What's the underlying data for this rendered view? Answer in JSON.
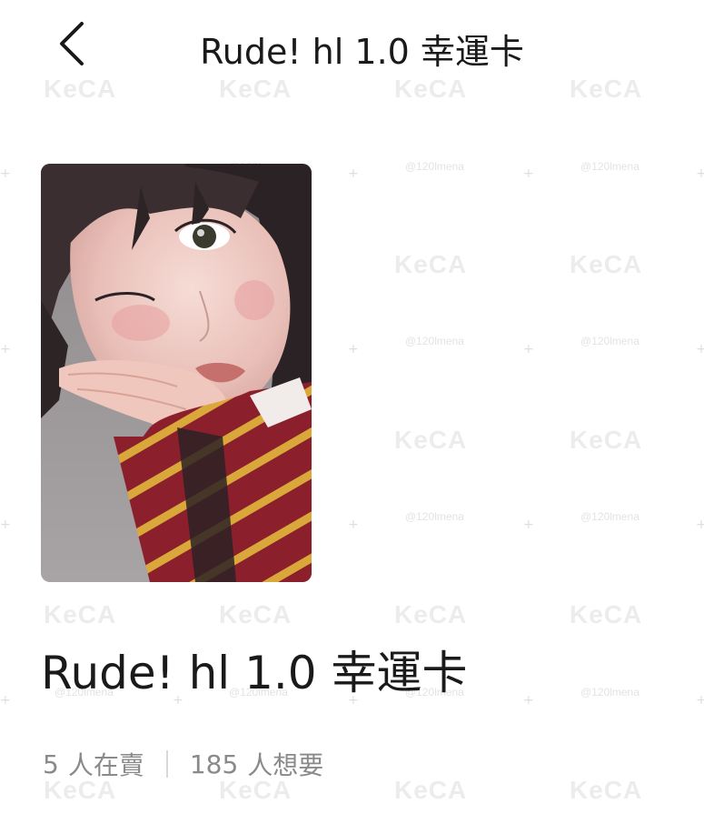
{
  "header": {
    "title": "Rude! hl 1.0 幸運卡",
    "back_icon": "chevron-left-icon"
  },
  "product": {
    "title": "Rude! hl 1.0 幸運卡"
  },
  "stats": {
    "selling_count": "5",
    "selling_label": "人在賣",
    "wanting_count": "185",
    "wanting_label": "人想要"
  },
  "watermark": {
    "logo_text": "KeCA",
    "username": "@120lmena"
  },
  "colors": {
    "text": "#1a1a1a",
    "muted": "#8a8a8a",
    "background": "#ffffff"
  }
}
